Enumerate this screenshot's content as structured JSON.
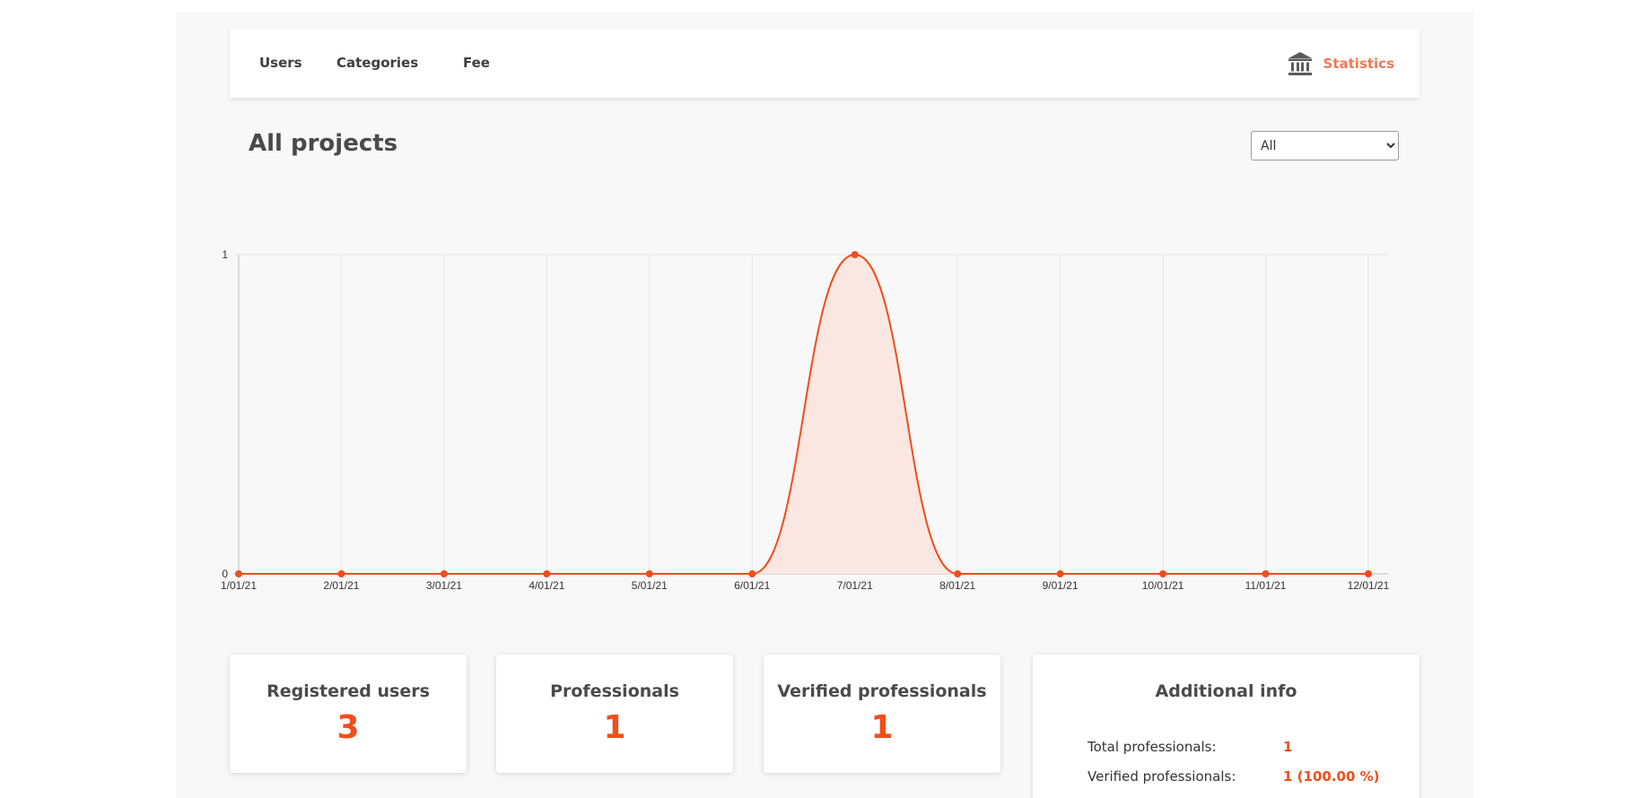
{
  "nav": {
    "users": "Users",
    "categories": "Categories",
    "fee": "Fee",
    "statistics": "Statistics"
  },
  "header": {
    "title": "All projects",
    "filter": {
      "selected": "All",
      "options": [
        "All"
      ]
    }
  },
  "colors": {
    "accent": "#f04e1b",
    "accent_fill": "#fbe7e1",
    "stats_link": "#ee7a55",
    "grid": "#e6e6e6",
    "axis": "#bdbdbd"
  },
  "chart_data": {
    "type": "area",
    "categories": [
      "1/01/21",
      "2/01/21",
      "3/01/21",
      "4/01/21",
      "5/01/21",
      "6/01/21",
      "7/01/21",
      "8/01/21",
      "9/01/21",
      "10/01/21",
      "11/01/21",
      "12/01/21"
    ],
    "series": [
      {
        "values": [
          0,
          0,
          0,
          0,
          0,
          0,
          1,
          0,
          0,
          0,
          0,
          0
        ]
      }
    ],
    "y_ticks": [
      "0",
      "1"
    ],
    "ylim": [
      0,
      1
    ],
    "grid": true
  },
  "cards": {
    "registered": {
      "title": "Registered users",
      "value": "3"
    },
    "professionals": {
      "title": "Professionals",
      "value": "1"
    },
    "verified": {
      "title": "Verified professionals",
      "value": "1"
    },
    "info": {
      "title": "Additional info",
      "total_label": "Total professionals:",
      "total_value": "1",
      "verified_label": "Verified professionals:",
      "verified_value": "1 (100.00 %)"
    }
  },
  "icons": {
    "statistics": "bank-icon"
  }
}
